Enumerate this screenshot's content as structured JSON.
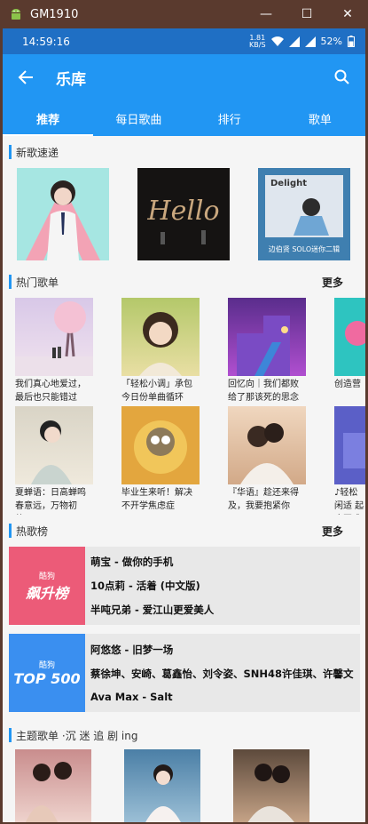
{
  "window": {
    "title": "GM1910",
    "minimize": "—",
    "maximize": "☐",
    "close": "✕"
  },
  "status": {
    "time": "14:59:16",
    "speed_top": "1.81",
    "speed_bottom": "KB/S",
    "battery": "52%"
  },
  "appbar": {
    "title": "乐库"
  },
  "tabs": [
    {
      "label": "推荐"
    },
    {
      "label": "每日歌曲"
    },
    {
      "label": "排行"
    },
    {
      "label": "歌单"
    }
  ],
  "new_songs": {
    "label": "新歌速递",
    "covers": [
      {
        "overlay_title": "",
        "overlay_sub": ""
      },
      {
        "overlay_title": "Hello",
        "overlay_sub": ""
      },
      {
        "overlay_title": "Delight",
        "overlay_sub": "边伯贤 SOLO迷你二辑"
      }
    ]
  },
  "hot_playlists": {
    "label": "热门歌单",
    "more": "更多",
    "row1": [
      {
        "name": "我们真心地爱过，最后也只能错过"
      },
      {
        "name": "「轻松小调」承包今日份单曲循环"
      },
      {
        "name": "回忆向｜我们都败给了那该死的思念"
      },
      {
        "name": "创造营"
      }
    ],
    "row2": [
      {
        "name": "夏蝉语：日高蝉鸣春意远，万物初壮…"
      },
      {
        "name": "毕业生来听！解决不开学焦虑症"
      },
      {
        "name": "『华语』趁还来得及，我要抱紧你"
      },
      {
        "name": "♪轻松闲适 起床困难"
      }
    ]
  },
  "charts": {
    "label": "热歌榜",
    "more": "更多",
    "boards": [
      {
        "brand": "酷狗",
        "name": "飙升榜",
        "color": "#ec5b78",
        "lines": [
          "萌宝 - 做你的手机",
          "10点莉 - 活着 (中文版)",
          "半吨兄弟 - 爱江山更爱美人"
        ]
      },
      {
        "brand": "酷狗",
        "name": "TOP 500",
        "color": "#3a8ff0",
        "lines": [
          "阿悠悠 - 旧梦一场",
          "蔡徐坤、安崎、葛鑫怡、刘令姿、SNH48许佳琪、许馨文",
          "Ava Max - Salt"
        ]
      }
    ]
  },
  "theme": {
    "label": "主题歌单 ·沉 迷 追 剧 ing"
  }
}
